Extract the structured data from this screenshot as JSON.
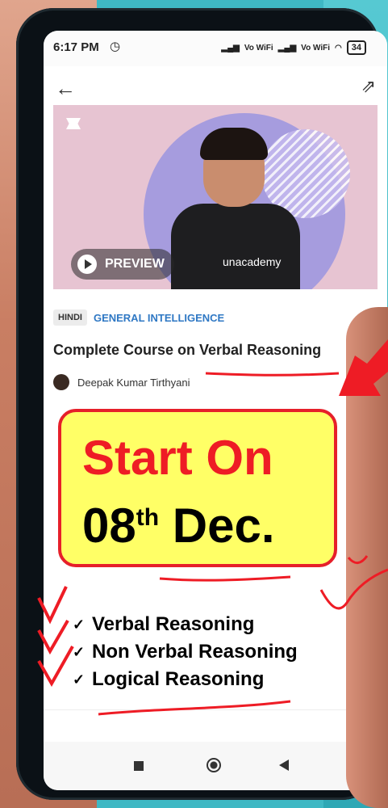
{
  "status_bar": {
    "time": "6:17 PM",
    "network_label_1": "Vo WiFi",
    "network_label_2": "Vo WiFi",
    "battery": "34"
  },
  "app_bar": {
    "back_icon": "arrow-left-icon",
    "share_icon": "share-icon"
  },
  "thumbnail": {
    "brand_text": "unacademy",
    "preview_label": "PREVIEW"
  },
  "course": {
    "language": "HINDI",
    "category": "GENERAL INTELLIGENCE",
    "title": "Complete Course on Verbal Reasoning",
    "educator": "Deepak Kumar Tirthyani"
  },
  "promo": {
    "line1": "Start On",
    "line2_day": "08",
    "line2_suffix": "th",
    "line2_month": " Dec."
  },
  "topics": [
    "Verbal Reasoning",
    "Non Verbal Reasoning",
    "Logical Reasoning"
  ],
  "colors": {
    "promo_bg": "#ffff66",
    "promo_border": "#e6202a",
    "promo_text": "#ee1c25",
    "category": "#2f78c4",
    "annotation": "#ee1c25"
  }
}
